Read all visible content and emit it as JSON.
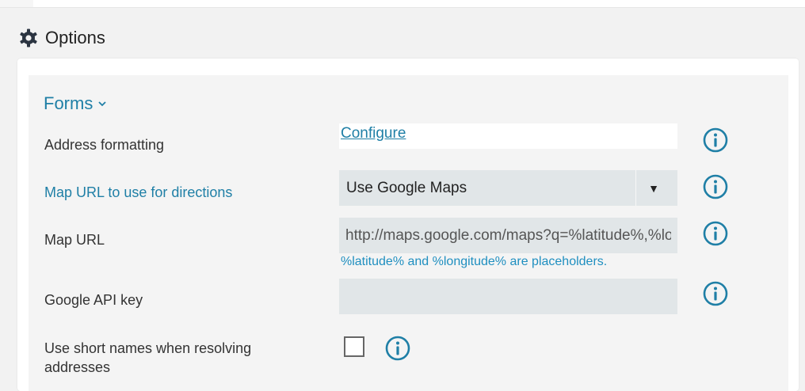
{
  "header": {
    "title": "Options",
    "icon": "gear-icon"
  },
  "forms": {
    "section_title": "Forms",
    "rows": {
      "address_formatting": {
        "label": "Address formatting",
        "link_label": "Configure"
      },
      "map_url_directions": {
        "label": "Map URL to use for directions",
        "selected": "Use Google Maps"
      },
      "map_url": {
        "label": "Map URL",
        "value": "http://maps.google.com/maps?q=%latitude%,%longitude%",
        "hint": "%latitude% and %longitude% are placeholders."
      },
      "google_api_key": {
        "label": "Google API key",
        "value": ""
      },
      "use_short_names": {
        "label_line1": "Use short names when resolving",
        "label_line2": "addresses",
        "checked": false
      }
    }
  },
  "colors": {
    "accent": "#1f7fa6",
    "input_bg": "#e1e6e8",
    "panel_bg": "#f4f4f4"
  }
}
